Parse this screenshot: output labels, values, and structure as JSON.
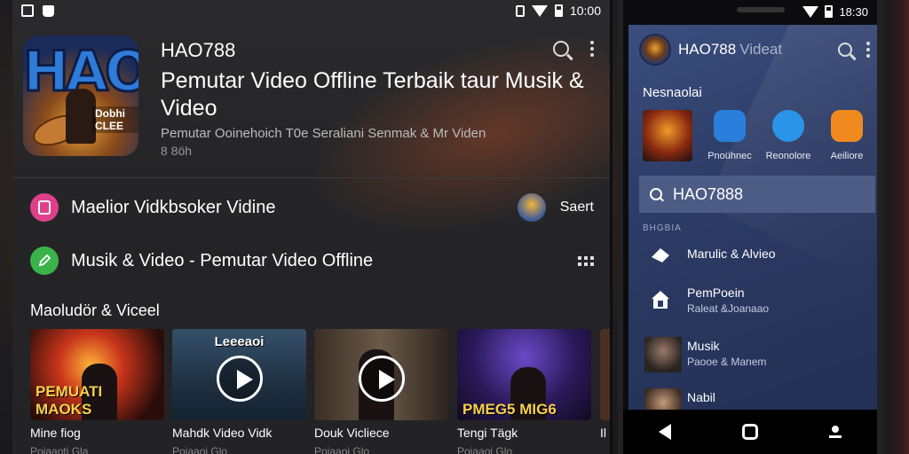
{
  "status_left": {
    "time": "10:00"
  },
  "status_right": {
    "time": "18:30"
  },
  "app": {
    "icon_text": "HAO",
    "icon_sub": "Dobhi CLEE",
    "name": "HAO788",
    "description": "Pemutar Video Offline Terbaik taur Musik & Video",
    "subtitle": "Pemutar Ooinehoich T0e Seraliani Senmak & Mr Viden",
    "rating": "8 8öh"
  },
  "rows": [
    {
      "label": "Maelior Vidkbsoker Vidine",
      "right_label": "Saert",
      "icon_color": "#e0408a"
    },
    {
      "label": "Musik & Video - Pemutar Video Offline",
      "icon_color": "#3bb34a"
    }
  ],
  "section": {
    "title": "Maoludör & Viceel"
  },
  "thumbnails": [
    {
      "caption": "PEMUATI MAOKS",
      "title": "Mine fiog",
      "meta": "Poiaaoti      Gla"
    },
    {
      "caption": "Leeeaoi",
      "title": "Mahdk Video Vidk",
      "meta": "Poiaaoi      Glo"
    },
    {
      "caption": "",
      "title": "Douk Vicliece",
      "meta": "Poiaaoi      Glo"
    },
    {
      "caption": "PMEG5 MIG6",
      "title": "Tengi Tägk",
      "meta": "Poiaaoi      Glo"
    },
    {
      "caption": "",
      "title": "Il",
      "meta": ""
    }
  ],
  "right_phone": {
    "title": "HAO788",
    "title_suffix": "Videat",
    "section_title": "Nesnaolai",
    "apps": [
      {
        "label": "Pnoühnec",
        "color": "#2a7fdc"
      },
      {
        "label": "Reonolore",
        "color": "#2a95e8"
      },
      {
        "label": "Aeiliore",
        "color": "#f08a1e"
      }
    ],
    "search_value": "HAO7888",
    "small_label": "BHGBIA",
    "items": [
      {
        "title": "Marulic & Alvieo",
        "sub": ""
      },
      {
        "title": "PemPoein",
        "sub": "Raleat &Joanaao"
      },
      {
        "title": "Musik",
        "sub": "Paooe & Manem"
      },
      {
        "title": "Nabil",
        "sub": ""
      }
    ]
  },
  "colors": {
    "accent_pink": "#e0408a",
    "accent_green": "#3bb34a",
    "right_bg": "#2d3c66"
  }
}
